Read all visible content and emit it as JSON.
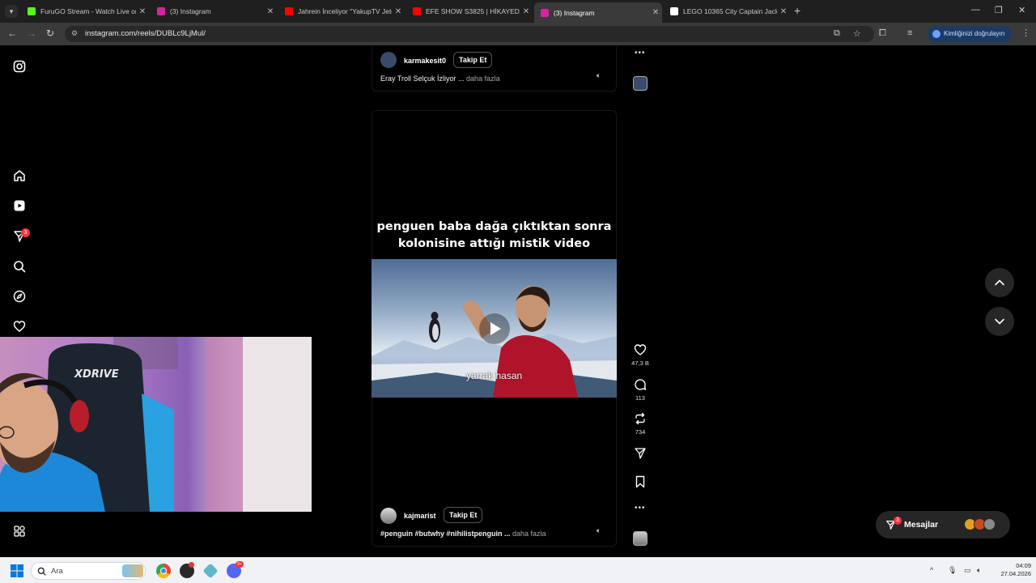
{
  "browser": {
    "tabs": [
      {
        "title": "FuruGO Stream - Watch Live on",
        "active": false,
        "favicon_color": "#53fc18"
      },
      {
        "title": "(3) Instagram",
        "active": false,
        "favicon_color": "#d6249f"
      },
      {
        "title": "Jahrein İnceliyor \"YakupTV Jeto",
        "active": false,
        "favicon_color": "#ff0000"
      },
      {
        "title": "EFE SHOW S3825 | HİKAYEDEN",
        "active": false,
        "favicon_color": "#ff0000"
      },
      {
        "title": "(3) Instagram",
        "active": true,
        "favicon_color": "#d6249f"
      },
      {
        "title": "LEGO 10365 City Captain Jack S",
        "active": false,
        "favicon_color": "#ffffff"
      }
    ],
    "url": "instagram.com/reels/DUBLc9LjMul/",
    "verify_label": "Kimliğinizi doğrulayın"
  },
  "sidebar": {
    "icons": [
      "instagram-logo-icon",
      "home-icon",
      "reels-icon",
      "direct-icon",
      "search-icon",
      "explore-icon",
      "heart-icon",
      "more-icon"
    ],
    "notification_count": "3"
  },
  "reel_previous": {
    "username": "karmakesit0",
    "follow_label": "Takip Et",
    "caption": "Eray Troll Selçuk İzliyor ...",
    "more_label": "daha fazla"
  },
  "reel_current": {
    "overlay_line1": "penguen baba dağa çıktıktan sonra",
    "overlay_line2": "kolonisine attığı mistik video",
    "subtitle": "yarrak hasan",
    "username": "kajmarist",
    "follow_label": "Takip Et",
    "caption": "#penguin #butwhy #nihilistpenguin ...",
    "more_label": "daha fazla",
    "likes": "47,3 B",
    "comments": "113",
    "reposts": "734"
  },
  "messages": {
    "label": "Mesajlar",
    "badge": "3"
  },
  "taskbar": {
    "search_placeholder": "Ara",
    "time": "04:09",
    "date": "27.04.2026"
  },
  "colors": {
    "accent_blue": "#1c3a64",
    "notification_red": "#ff3040",
    "background": "#000000"
  }
}
